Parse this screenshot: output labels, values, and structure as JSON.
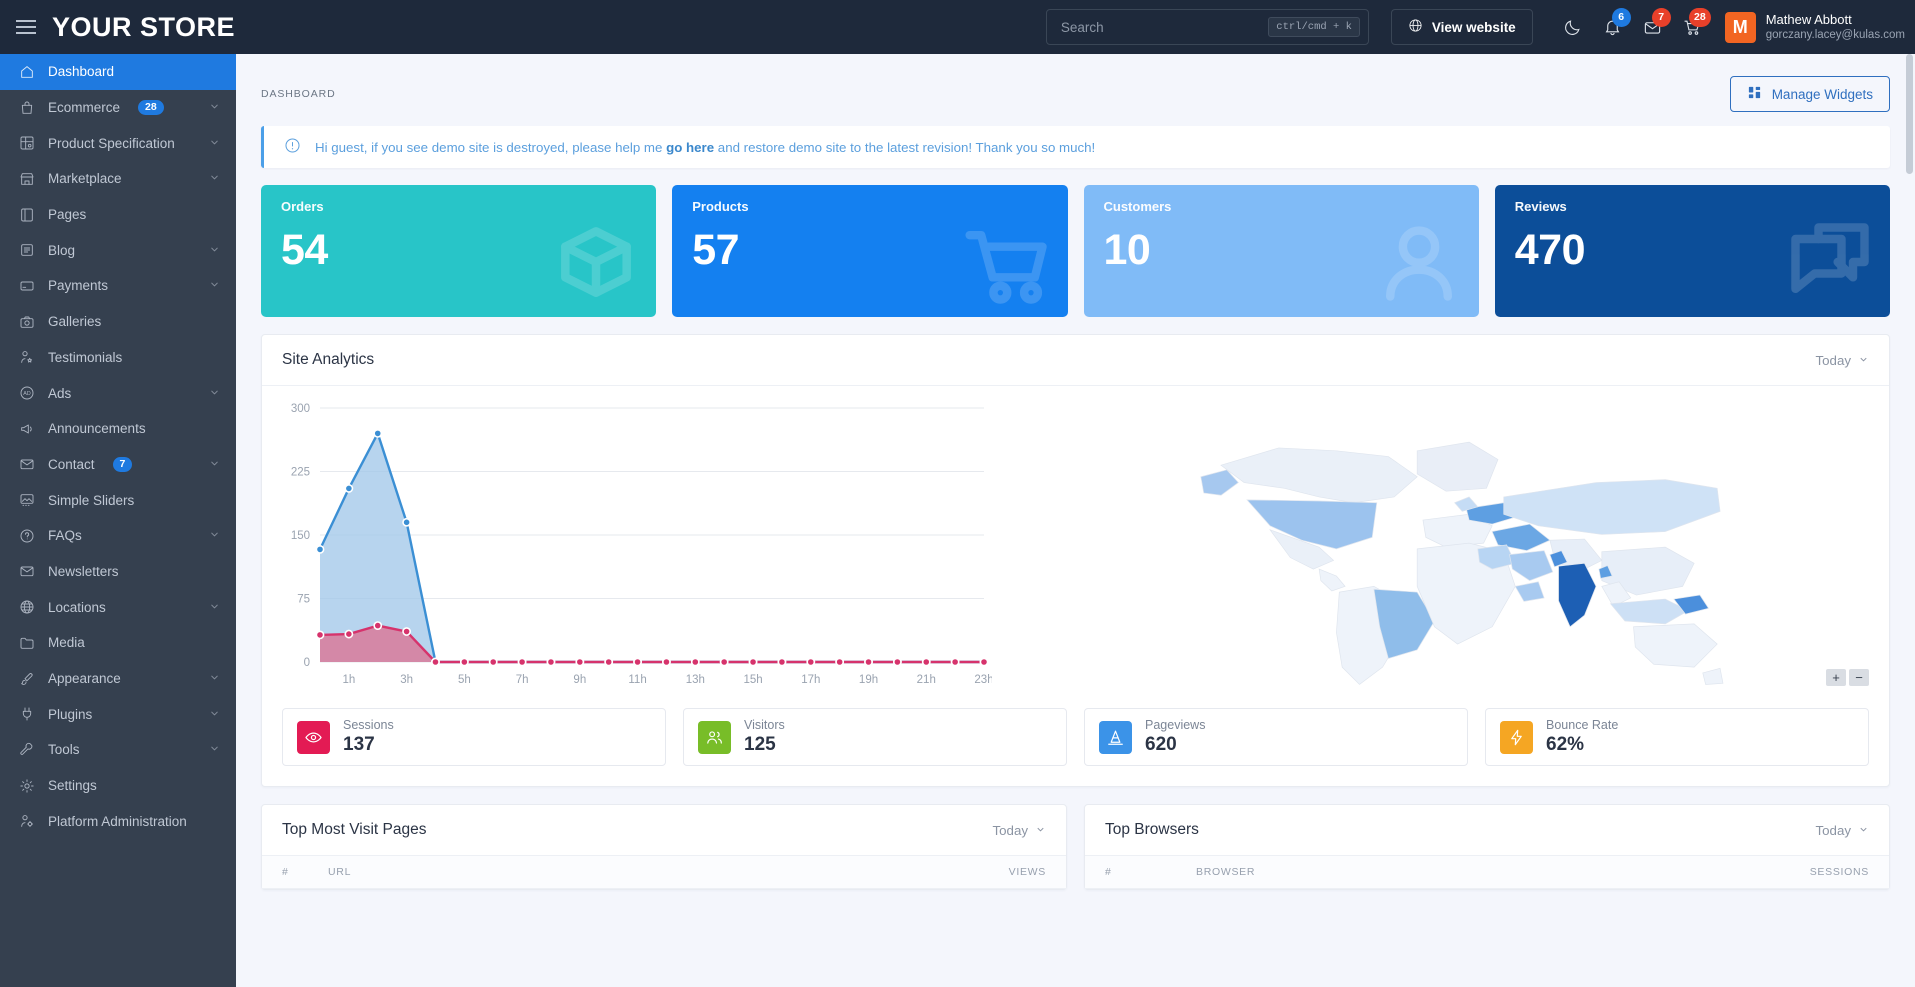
{
  "brand": {
    "title": "YOUR STORE",
    "menu_icon": "hamburger-icon"
  },
  "topbar": {
    "search": {
      "placeholder": "Search",
      "value": "",
      "shortcut": "ctrl/cmd + k"
    },
    "view_website": "View website",
    "icons": [
      {
        "name": "moon-icon",
        "badge": null
      },
      {
        "name": "bell-icon",
        "badge": "6",
        "badge_color": "#1f7ae0"
      },
      {
        "name": "envelope-icon",
        "badge": "7",
        "badge_color": "#e8402a"
      },
      {
        "name": "cart-icon",
        "badge": "28",
        "badge_color": "#e8402a"
      }
    ],
    "user": {
      "initial": "M",
      "name": "Mathew Abbott",
      "email": "gorczany.lacey@kulas.com",
      "avatar_color": "#f26522"
    }
  },
  "sidebar": {
    "items": [
      {
        "label": "Dashboard",
        "icon": "home-icon",
        "active": true,
        "badge": null,
        "chevron": false
      },
      {
        "label": "Ecommerce",
        "icon": "bag-icon",
        "active": false,
        "badge": "28",
        "chevron": true
      },
      {
        "label": "Product Specification",
        "icon": "grid-settings-icon",
        "active": false,
        "badge": null,
        "chevron": true
      },
      {
        "label": "Marketplace",
        "icon": "store-icon",
        "active": false,
        "badge": null,
        "chevron": true
      },
      {
        "label": "Pages",
        "icon": "book-icon",
        "active": false,
        "badge": null,
        "chevron": false
      },
      {
        "label": "Blog",
        "icon": "article-icon",
        "active": false,
        "badge": null,
        "chevron": true
      },
      {
        "label": "Payments",
        "icon": "credit-card-icon",
        "active": false,
        "badge": null,
        "chevron": true
      },
      {
        "label": "Galleries",
        "icon": "camera-icon",
        "active": false,
        "badge": null,
        "chevron": false
      },
      {
        "label": "Testimonials",
        "icon": "user-star-icon",
        "active": false,
        "badge": null,
        "chevron": false
      },
      {
        "label": "Ads",
        "icon": "ad-circle-icon",
        "active": false,
        "badge": null,
        "chevron": true
      },
      {
        "label": "Announcements",
        "icon": "megaphone-icon",
        "active": false,
        "badge": null,
        "chevron": false
      },
      {
        "label": "Contact",
        "icon": "envelope-icon",
        "active": false,
        "badge": "7",
        "chevron": true
      },
      {
        "label": "Simple Sliders",
        "icon": "image-icon",
        "active": false,
        "badge": null,
        "chevron": false
      },
      {
        "label": "FAQs",
        "icon": "question-circle-icon",
        "active": false,
        "badge": null,
        "chevron": true
      },
      {
        "label": "Newsletters",
        "icon": "envelope-icon",
        "active": false,
        "badge": null,
        "chevron": false
      },
      {
        "label": "Locations",
        "icon": "globe-icon",
        "active": false,
        "badge": null,
        "chevron": true
      },
      {
        "label": "Media",
        "icon": "folder-icon",
        "active": false,
        "badge": null,
        "chevron": false
      },
      {
        "label": "Appearance",
        "icon": "brush-icon",
        "active": false,
        "badge": null,
        "chevron": true
      },
      {
        "label": "Plugins",
        "icon": "plug-icon",
        "active": false,
        "badge": null,
        "chevron": true
      },
      {
        "label": "Tools",
        "icon": "wrench-icon",
        "active": false,
        "badge": null,
        "chevron": true
      },
      {
        "label": "Settings",
        "icon": "gear-icon",
        "active": false,
        "badge": null,
        "chevron": false
      },
      {
        "label": "Platform Administration",
        "icon": "user-cog-icon",
        "active": false,
        "badge": null,
        "chevron": false
      }
    ]
  },
  "page": {
    "breadcrumb": "DASHBOARD",
    "manage_widgets": "Manage Widgets",
    "alert": {
      "prefix": "Hi guest, if you see demo site is destroyed, please help me ",
      "link": "go here",
      "suffix": " and restore demo site to the latest revision! Thank you so much!"
    }
  },
  "stats": [
    {
      "label": "Orders",
      "value": "54",
      "color": "#28c5c8",
      "icon": "box-icon"
    },
    {
      "label": "Products",
      "value": "57",
      "color": "#1480f0",
      "icon": "cart-icon"
    },
    {
      "label": "Customers",
      "value": "10",
      "color": "#80bbf7",
      "icon": "user-icon"
    },
    {
      "label": "Reviews",
      "value": "470",
      "color": "#0c4e99",
      "icon": "chat-icon"
    }
  ],
  "analytics": {
    "title": "Site Analytics",
    "range": "Today",
    "metrics": [
      {
        "label": "Sessions",
        "value": "137",
        "color": "#e31b54",
        "icon": "eye-icon"
      },
      {
        "label": "Visitors",
        "value": "125",
        "color": "#78bd28",
        "icon": "users-icon"
      },
      {
        "label": "Pageviews",
        "value": "620",
        "color": "#3b93e8",
        "icon": "cone-icon"
      },
      {
        "label": "Bounce Rate",
        "value": "62%",
        "color": "#f5a623",
        "icon": "bolt-icon"
      }
    ],
    "map": {
      "zoom_in": "+",
      "zoom_out": "−"
    }
  },
  "chart_data": {
    "type": "area",
    "title": "Site Analytics",
    "xlabel": "",
    "ylabel": "",
    "ylim": [
      0,
      300
    ],
    "yticks": [
      0,
      75,
      150,
      225,
      300
    ],
    "grid": true,
    "legend": "none",
    "x": [
      "0h",
      "1h",
      "2h",
      "3h",
      "4h",
      "5h",
      "6h",
      "7h",
      "8h",
      "9h",
      "10h",
      "11h",
      "12h",
      "13h",
      "14h",
      "15h",
      "16h",
      "17h",
      "18h",
      "19h",
      "20h",
      "21h",
      "22h",
      "23h"
    ],
    "xtick_labels": [
      "1h",
      "3h",
      "5h",
      "7h",
      "9h",
      "11h",
      "13h",
      "15h",
      "17h",
      "19h",
      "21h",
      "23h"
    ],
    "series": [
      {
        "name": "Pageviews",
        "color": "#3b8fd4",
        "fill": "#9fc5e8",
        "values": [
          133,
          205,
          270,
          165,
          0,
          0,
          0,
          0,
          0,
          0,
          0,
          0,
          0,
          0,
          0,
          0,
          0,
          0,
          0,
          0,
          0,
          0,
          0,
          0
        ]
      },
      {
        "name": "Sessions",
        "color": "#d6336c",
        "fill": "#d97a9a",
        "values": [
          32,
          33,
          43,
          36,
          0,
          0,
          0,
          0,
          0,
          0,
          0,
          0,
          0,
          0,
          0,
          0,
          0,
          0,
          0,
          0,
          0,
          0,
          0,
          0
        ]
      }
    ]
  },
  "top_pages": {
    "title": "Top Most Visit Pages",
    "range": "Today",
    "columns": [
      "#",
      "URL",
      "VIEWS"
    ],
    "rows": []
  },
  "top_browsers": {
    "title": "Top Browsers",
    "range": "Today",
    "columns": [
      "#",
      "BROWSER",
      "SESSIONS"
    ],
    "rows": []
  }
}
